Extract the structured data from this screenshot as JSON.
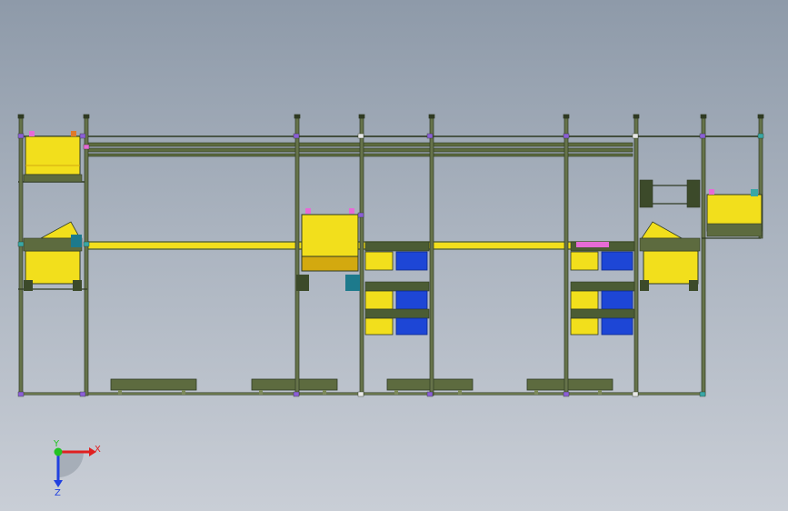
{
  "viewport": {
    "background_top": "#8e9aa9",
    "background_bottom": "#c9ced6"
  },
  "colors": {
    "frame": "#66734a",
    "frame_dark": "#2f3a23",
    "rail": "#5d6b3f",
    "yellow": "#f2df1c",
    "yellow_dark": "#d3a90f",
    "blue": "#1d46d6",
    "blue_dark": "#0e2a8c",
    "connector_purple": "#8b5fd6",
    "connector_pink": "#e66bd6",
    "connector_teal": "#3aa7a6"
  },
  "triad": {
    "x_label": "X",
    "y_label": "Y",
    "z_label": "Z",
    "x_color": "#e02020",
    "y_color": "#22c322",
    "z_color": "#2040e0",
    "icon": "coordinate-triad-icon"
  }
}
